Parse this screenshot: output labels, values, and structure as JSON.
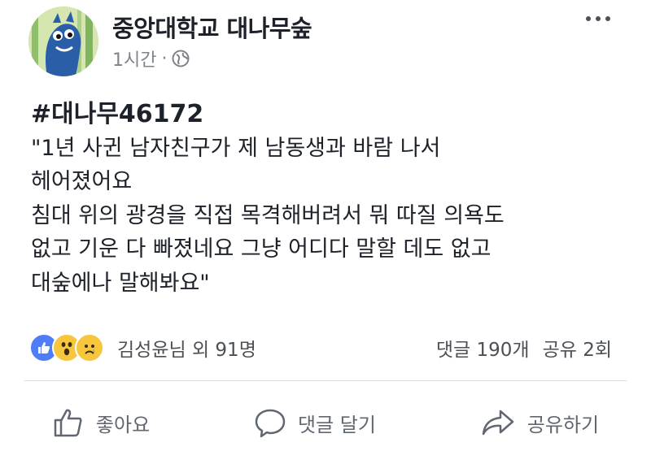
{
  "post": {
    "page_name": "중앙대학교 대나무숲",
    "time": "1시간",
    "meta_separator": "·",
    "hashtag": "#대나무46172",
    "lines": [
      "\"1년 사귄 남자친구가 제 남동생과 바람 나서",
      "헤어졌어요",
      "침대 위의 광경을 직접 목격해버려서 뭐 따질 의욕도",
      "없고 기운 다 빠졌네요 그냥 어디다 말할 데도 없고",
      "대숲에나 말해봐요\""
    ]
  },
  "reactions": {
    "icons": [
      "like-icon",
      "wow-icon",
      "sad-icon"
    ],
    "summary": "김성윤님 외 91명",
    "comments": "댓글 190개",
    "shares": "공유 2회"
  },
  "actions": {
    "like": "좋아요",
    "comment": "댓글 달기",
    "share": "공유하기"
  },
  "colors": {
    "text": "#1d2129",
    "muted": "#606770",
    "like_blue": "#4f7cf7",
    "emoji_yellow": "#f7c63c"
  }
}
